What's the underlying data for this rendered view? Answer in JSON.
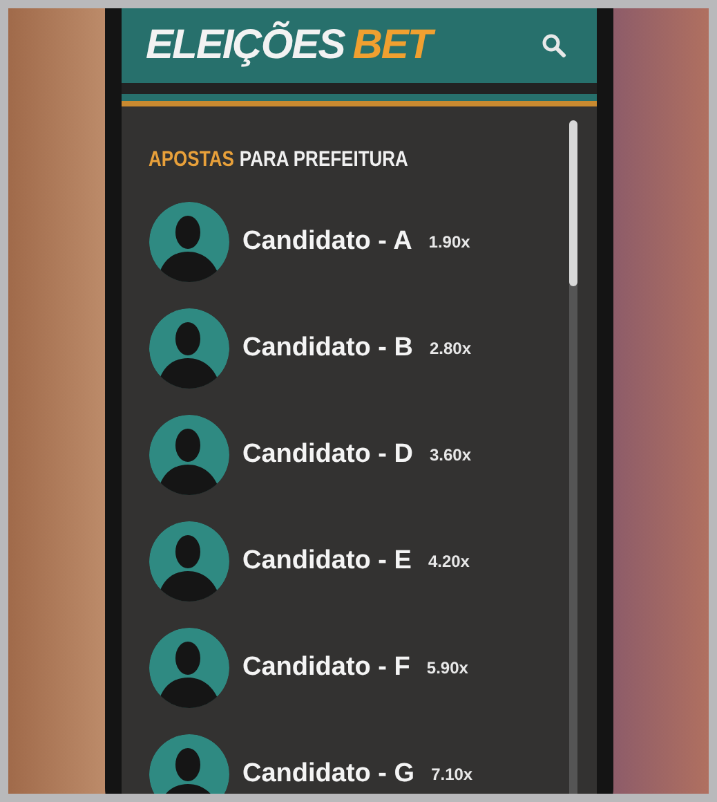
{
  "header": {
    "logo_main": "ELEIÇÕES",
    "logo_accent": "BET"
  },
  "section": {
    "title_accent": "APOSTAS",
    "title_rest": "PARA PREFEITURA"
  },
  "candidates": [
    {
      "name": "Candidato - A",
      "odds": "1.90x"
    },
    {
      "name": "Candidato - B",
      "odds": "2.80x"
    },
    {
      "name": "Candidato - D",
      "odds": "3.60x"
    },
    {
      "name": "Candidato - E",
      "odds": "4.20x"
    },
    {
      "name": "Candidato - F",
      "odds": "5.90x"
    },
    {
      "name": "Candidato - G",
      "odds": "7.10x"
    }
  ]
}
